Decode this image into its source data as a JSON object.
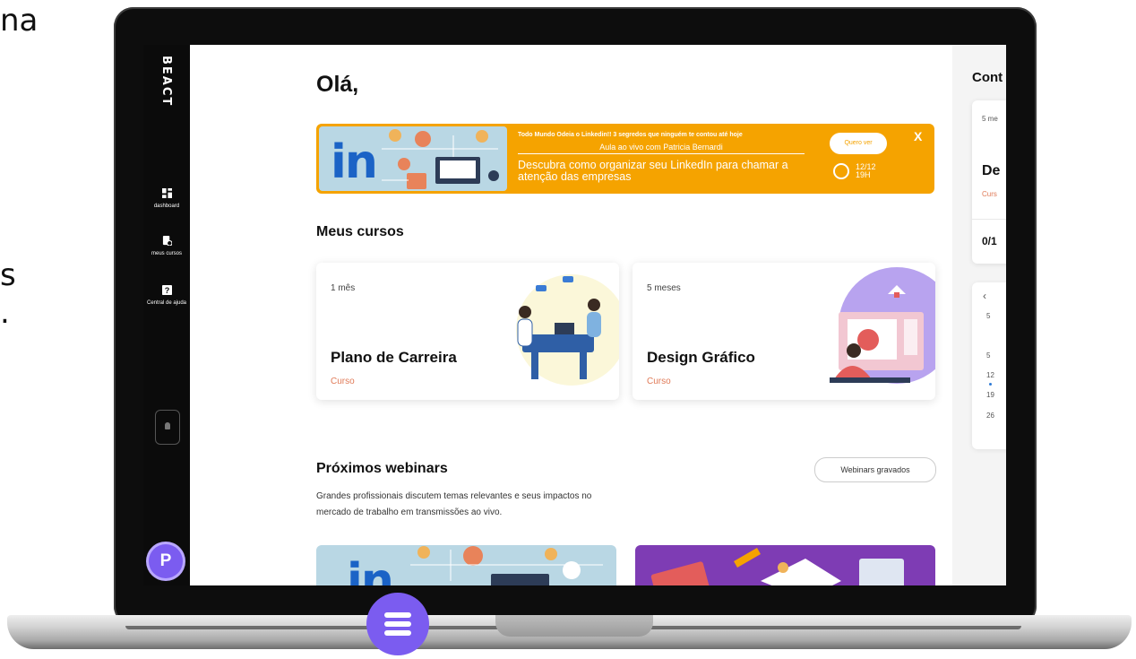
{
  "background_fragments": [
    "na",
    "s",
    "."
  ],
  "sidebar": {
    "logo": "BEACT",
    "items": [
      {
        "label": "dashboard",
        "icon": "dashboard-icon"
      },
      {
        "label": "meus cursos",
        "icon": "courses-icon"
      },
      {
        "label": "Central de ajuda",
        "icon": "help-icon"
      }
    ],
    "avatar_initial": "P"
  },
  "main": {
    "greeting": "Olá,",
    "banner": {
      "small_title": "Todo Mundo Odeia o Linkedin!! 3 segredos que ninguém te contou até hoje",
      "subtitle": "Aula ao vivo com Patricia Bernardi",
      "headline": "Descubra como organizar seu LinkedIn para chamar a atenção das empresas",
      "button": "Quero ver",
      "close": "X",
      "date": "12/12",
      "time": "19H",
      "logo_text": "in",
      "color": "#f5a300"
    },
    "courses_title": "Meus cursos",
    "courses": [
      {
        "duration": "1 mês",
        "title": "Plano de Carreira",
        "type": "Curso"
      },
      {
        "duration": "5 meses",
        "title": "Design Gráfico",
        "type": "Curso"
      }
    ],
    "webinars": {
      "title": "Próximos webinars",
      "button": "Webinars gravados",
      "description": "Grandes profissionais discutem temas relevantes e seus impactos no mercado de trabalho em transmissões ao vivo."
    }
  },
  "right_panel": {
    "title": "Cont",
    "card": {
      "duration": "5 me",
      "title": "De",
      "type": "Curs",
      "progress": "0/1"
    },
    "calendar": {
      "prev": "‹",
      "days": [
        "5",
        "5",
        "12",
        "19",
        "26"
      ]
    }
  },
  "colors": {
    "accent": "#7b5cf0",
    "orange": "#f5a300",
    "course_type": "#e07a57"
  }
}
